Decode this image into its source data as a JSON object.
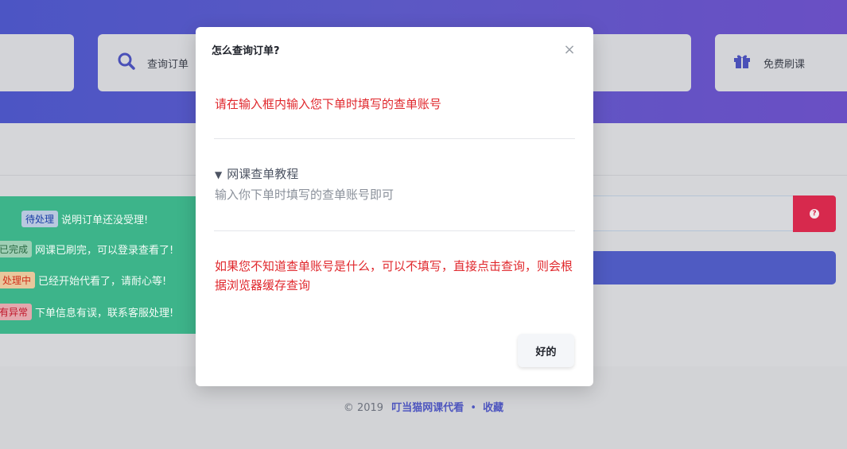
{
  "hero": {
    "query_card_label": "查询订单",
    "gift_card_label": "免费刷课",
    "icons": {
      "query": "search-icon",
      "gift": "gift-icon"
    }
  },
  "legend": {
    "rows": [
      {
        "badge": "待处理",
        "text": "说明订单还没受理!"
      },
      {
        "badge": "已完成",
        "text": "网课已刷完，可以登录查看了!"
      },
      {
        "badge": "处理中",
        "text": "已经开始代看了，请耐心等!"
      },
      {
        "badge": "有异常",
        "text": "下单信息有误，联系客服处理!"
      }
    ]
  },
  "query": {
    "help_icon": "question-circle-icon",
    "help_glyph": "?"
  },
  "footer": {
    "copyright": "© 2019",
    "brand": "叮当猫网课代看",
    "separator": "•",
    "favorite": "收藏"
  },
  "modal": {
    "title": "怎么查询订单?",
    "close_glyph": "×",
    "instruction": "请在输入框内输入您下单时填写的查单账号",
    "tutorial_summary": "网课查单教程",
    "tutorial_marker": "▼",
    "tutorial_body": "输入你下单时填写的查单账号即可",
    "note": "如果您不知道查单账号是什么，可以不填写，直接点击查询，则会根据浏览器缓存查询",
    "ok_label": "好的"
  },
  "colors": {
    "accent": "#5157c4",
    "danger": "#e0282d",
    "legend_bg": "#3db48a",
    "help_button": "#d7294d"
  }
}
